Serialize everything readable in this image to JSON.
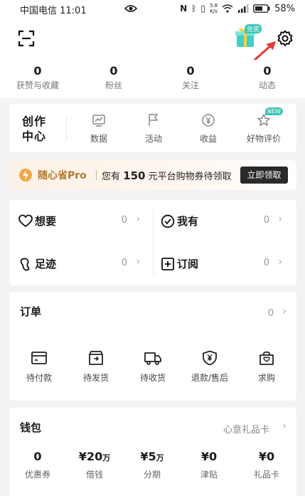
{
  "status_bar": {
    "carrier_time": "中国电信 11:01",
    "speed_value": "5.8",
    "speed_unit": "K/s",
    "battery": "58%"
  },
  "header": {
    "redeem_badge": "兑奖"
  },
  "stats": [
    {
      "value": "0",
      "label": "获赞与收藏"
    },
    {
      "value": "0",
      "label": "粉丝"
    },
    {
      "value": "0",
      "label": "关注"
    },
    {
      "value": "0",
      "label": "动态"
    }
  ],
  "creator": {
    "label_line1": "创作",
    "label_line2": "中心",
    "items": [
      {
        "label": "数据",
        "icon": "chart-icon"
      },
      {
        "label": "活动",
        "icon": "flag-icon"
      },
      {
        "label": "收益",
        "icon": "yen-coin-icon"
      },
      {
        "label": "好物评价",
        "icon": "star-icon",
        "badge": "NEW"
      }
    ]
  },
  "promo": {
    "brand": "随心省Pro",
    "text_prefix": "您有",
    "amount": "150",
    "text_suffix": "元平台购物券待领取",
    "button": "立即领取"
  },
  "quick": [
    {
      "label": "想要",
      "count": "0",
      "icon": "heart-icon"
    },
    {
      "label": "我有",
      "count": "0",
      "icon": "check-circle-icon"
    },
    {
      "label": "足迹",
      "count": "0",
      "icon": "footprint-icon"
    },
    {
      "label": "订阅",
      "count": "0",
      "icon": "plus-box-icon"
    }
  ],
  "orders": {
    "title": "订单",
    "count": "0",
    "items": [
      {
        "label": "待付款",
        "icon": "card-icon"
      },
      {
        "label": "待发货",
        "icon": "box-icon"
      },
      {
        "label": "待收货",
        "icon": "truck-icon"
      },
      {
        "label": "退款/售后",
        "icon": "shield-yen-icon"
      },
      {
        "label": "求购",
        "icon": "bag-icon"
      }
    ]
  },
  "wallet": {
    "title": "钱包",
    "link": "心意礼品卡",
    "items": [
      {
        "value": "0",
        "unit": "",
        "label": "优惠券"
      },
      {
        "value": "¥20",
        "unit": "万",
        "label": "借钱"
      },
      {
        "value": "¥5",
        "unit": "万",
        "label": "分期"
      },
      {
        "value": "¥0",
        "unit": "",
        "label": "津贴"
      },
      {
        "value": "¥0",
        "unit": "",
        "label": "礼品卡"
      }
    ]
  },
  "colors": {
    "accent_arrow": "#e53935",
    "promo_gold": "#b8782f",
    "new_badge": "#39c6b5"
  }
}
